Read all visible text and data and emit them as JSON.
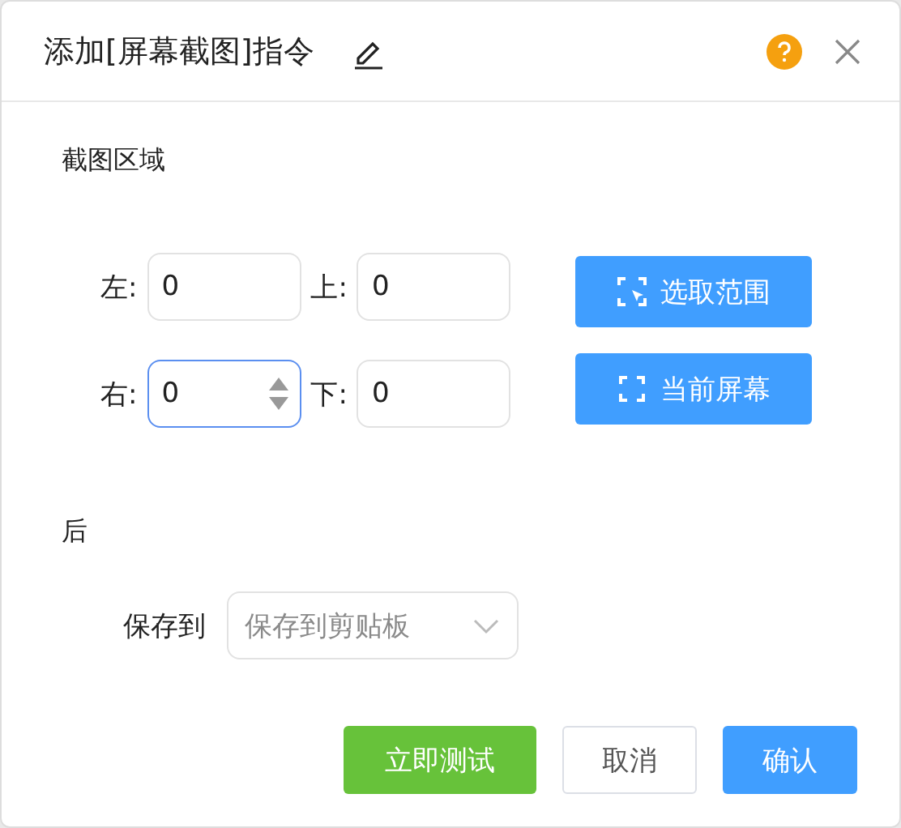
{
  "dialog": {
    "title": "添加[屏幕截图]指令"
  },
  "section_title": "截图区域",
  "fields": [
    {
      "label": "左:",
      "value": "0",
      "focused": false
    },
    {
      "label": "上:",
      "value": "0",
      "focused": false
    },
    {
      "label": "右:",
      "value": "0",
      "focused": true
    },
    {
      "label": "下:",
      "value": "0",
      "focused": false
    }
  ],
  "region_buttons": [
    {
      "kind": "select",
      "label": "选取范围"
    },
    {
      "kind": "screen",
      "label": "当前屏幕"
    }
  ],
  "after_title": "后",
  "save_to": {
    "label": "保存到",
    "placeholder": "保存到剪贴板"
  },
  "footer_buttons": [
    {
      "kind": "test",
      "label": "立即测试"
    },
    {
      "kind": "cancel",
      "label": "取消"
    },
    {
      "kind": "confirm",
      "label": "确认"
    }
  ]
}
